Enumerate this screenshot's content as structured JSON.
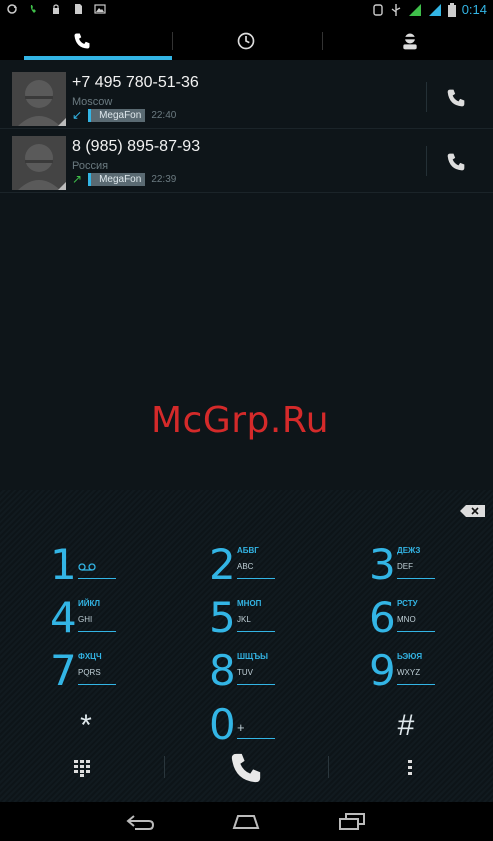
{
  "status_bar": {
    "time": "0:14",
    "left_icons": [
      "sync-icon",
      "phone-activity-icon",
      "lock-icon",
      "sd-card-icon",
      "image-icon"
    ],
    "right_icons": [
      "screenshot-icon",
      "usb-icon",
      "signal-icon",
      "signal-icon",
      "battery-icon"
    ]
  },
  "tabs": [
    {
      "name": "tab-phone",
      "icon": "phone-icon",
      "selected": true
    },
    {
      "name": "tab-recent",
      "icon": "clock-icon",
      "selected": false
    },
    {
      "name": "tab-contacts",
      "icon": "contact-icon",
      "selected": false
    }
  ],
  "call_log": [
    {
      "number": "+7 495 780-51-36",
      "location": "Moscow",
      "direction": "incoming",
      "arrow": "↙",
      "sim": "MegaFon",
      "time": "22:40"
    },
    {
      "number": "8 (985) 895-87-93",
      "location": "Россия",
      "direction": "outgoing",
      "arrow": "↗",
      "sim": "MegaFon",
      "time": "22:39"
    }
  ],
  "watermark": "McGrp.Ru",
  "dialpad": {
    "keys": [
      {
        "digit": "1",
        "cyr": "",
        "lat": "",
        "voicemail": true
      },
      {
        "digit": "2",
        "cyr": "АБВГ",
        "lat": "ABC"
      },
      {
        "digit": "3",
        "cyr": "ДЕЖЗ",
        "lat": "DEF"
      },
      {
        "digit": "4",
        "cyr": "ИЙКЛ",
        "lat": "GHI"
      },
      {
        "digit": "5",
        "cyr": "МНОП",
        "lat": "JKL"
      },
      {
        "digit": "6",
        "cyr": "РСТУ",
        "lat": "MNO"
      },
      {
        "digit": "7",
        "cyr": "ФХЦЧ",
        "lat": "PQRS"
      },
      {
        "digit": "8",
        "cyr": "ШЩЪЫ",
        "lat": "TUV"
      },
      {
        "digit": "9",
        "cyr": "ЬЭЮЯ",
        "lat": "WXYZ"
      },
      {
        "digit": "*",
        "cyr": "",
        "lat": ""
      },
      {
        "digit": "0",
        "cyr": "",
        "lat": "+"
      },
      {
        "digit": "#",
        "cyr": "",
        "lat": ""
      }
    ],
    "colors": {
      "accent": "#33b5e5",
      "background": "#0d1418"
    }
  },
  "actions": [
    "dialpad-grid-icon",
    "call-icon",
    "overflow-menu-icon"
  ],
  "navbar": [
    "back-icon",
    "home-icon",
    "recent-apps-icon"
  ]
}
